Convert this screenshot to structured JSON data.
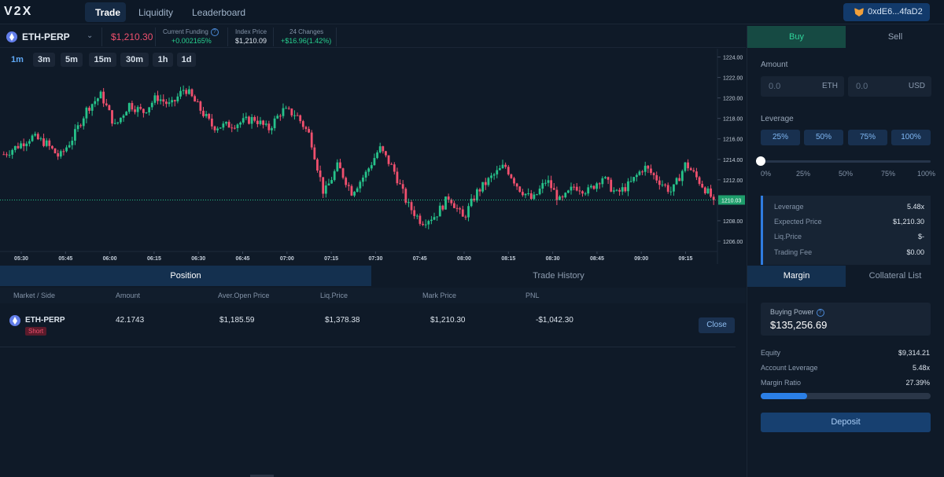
{
  "header": {
    "logo": "V2X",
    "nav": [
      {
        "label": "Trade",
        "active": true
      },
      {
        "label": "Liquidity",
        "active": false
      },
      {
        "label": "Leaderboard",
        "active": false
      }
    ],
    "wallet": "0xdE6...4faD2"
  },
  "ticker": {
    "market": "ETH-PERP",
    "price": "$1,210.30",
    "funding_label": "Current Funding",
    "funding_value": "+0.002165%",
    "index_label": "Index Price",
    "index_value": "$1,210.09",
    "change_label": "24 Changes",
    "change_value": "+$16.96(1.42%)"
  },
  "intervals": [
    "1m",
    "3m",
    "5m",
    "15m",
    "30m",
    "1h",
    "1d"
  ],
  "active_interval": "1m",
  "chart_data": {
    "type": "candlestick",
    "y_ticks": [
      "1224.00",
      "1222.00",
      "1220.00",
      "1218.00",
      "1216.00",
      "1214.00",
      "1212.00",
      "1210.00",
      "1208.00",
      "1206.00"
    ],
    "ylim": [
      1205.0,
      1224.5
    ],
    "x_ticks": [
      "05:30",
      "05:45",
      "06:00",
      "06:15",
      "06:30",
      "06:45",
      "07:00",
      "07:15",
      "07:30",
      "07:45",
      "08:00",
      "08:15",
      "08:30",
      "08:45",
      "09:00",
      "09:15"
    ],
    "last_price_label": "1210.03",
    "last_price": 1210.03,
    "up_color": "#26c28a",
    "down_color": "#f0506e",
    "close_path": [
      1214.5,
      1215.3,
      1216.2,
      1215.6,
      1214.2,
      1216.2,
      1219.0,
      1220.3,
      1217.2,
      1219.4,
      1218.6,
      1220.1,
      1219.2,
      1221.0,
      1219.1,
      1217.2,
      1217.3,
      1217.6,
      1218.0,
      1216.9,
      1218.8,
      1218.4,
      1216.3,
      1210.6,
      1213.4,
      1210.8,
      1212.6,
      1215.1,
      1213.0,
      1209.6,
      1207.9,
      1208.5,
      1210.4,
      1208.2,
      1210.8,
      1212.2,
      1213.4,
      1211.2,
      1210.0,
      1212.0,
      1209.8,
      1211.4,
      1210.9,
      1212.3,
      1210.6,
      1211.6,
      1213.3,
      1212.0,
      1210.8,
      1213.6,
      1211.8,
      1210.0
    ]
  },
  "bottom_tabs": {
    "position": "Position",
    "history": "Trade History"
  },
  "table": {
    "headers": [
      "Market / Side",
      "Amount",
      "Aver.Open Price",
      "Liq.Price",
      "Mark Price",
      "PNL"
    ],
    "rows": [
      {
        "market": "ETH-PERP",
        "side": "Short",
        "amount": "42.1743",
        "open": "$1,185.59",
        "liq": "$1,378.38",
        "mark": "$1,210.30",
        "pnl": "-$1,042.30",
        "action": "Close"
      }
    ]
  },
  "order": {
    "buy": "Buy",
    "sell": "Sell",
    "amount_label": "Amount",
    "amount_eth_placeholder": "0.0",
    "amount_eth_unit": "ETH",
    "amount_usd_placeholder": "0.0",
    "amount_usd_unit": "USD",
    "leverage_label": "Leverage",
    "leverage_buttons": [
      "25%",
      "50%",
      "75%",
      "100%"
    ],
    "slider_ticks": [
      "0%",
      "25%",
      "50%",
      "75%",
      "100%"
    ],
    "slider_value": 0,
    "summary": [
      {
        "label": "Leverage",
        "value": "5.48x"
      },
      {
        "label": "Expected Price",
        "value": "$1,210.30"
      },
      {
        "label": "Liq.Price",
        "value": "$-"
      },
      {
        "label": "Trading Fee",
        "value": "$0.00"
      }
    ]
  },
  "margin": {
    "tab_margin": "Margin",
    "tab_collateral": "Collateral List",
    "buying_power_label": "Buying Power",
    "buying_power": "$135,256.69",
    "rows": [
      {
        "label": "Equity",
        "value": "$9,314.21"
      },
      {
        "label": "Account Leverage",
        "value": "5.48x"
      },
      {
        "label": "Margin Ratio",
        "value": "27.39%"
      }
    ],
    "margin_ratio_fraction": 0.2739,
    "deposit": "Deposit"
  }
}
